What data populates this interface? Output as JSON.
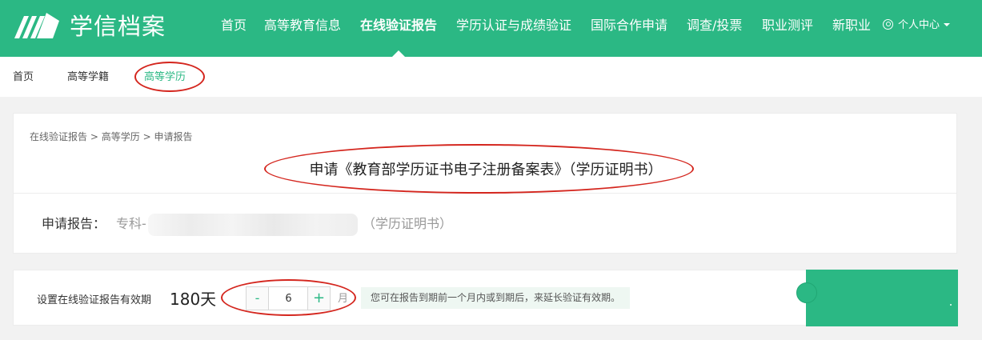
{
  "header": {
    "brand": "学信档案",
    "nav": [
      {
        "label": "首页"
      },
      {
        "label": "高等教育信息"
      },
      {
        "label": "在线验证报告"
      },
      {
        "label": "学历认证与成绩验证"
      },
      {
        "label": "国际合作申请"
      },
      {
        "label": "调查/投票"
      },
      {
        "label": "职业测评"
      },
      {
        "label": "新职业"
      }
    ],
    "active_nav": "在线验证报告",
    "user_menu": "个人中心"
  },
  "subnav": {
    "items": [
      {
        "label": "首页"
      },
      {
        "label": "高等学籍"
      },
      {
        "label": "高等学历"
      }
    ],
    "active": "高等学历"
  },
  "breadcrumb": {
    "items": [
      "在线验证报告",
      "高等学历",
      "申请报告"
    ],
    "separator": ">"
  },
  "page": {
    "title": "申请《教育部学历证书电子注册备案表》（学历证明书）",
    "apply_label": "申请报告：",
    "apply_value": "专科-",
    "apply_suffix": "（学历证明书）"
  },
  "validity": {
    "label": "设置在线验证报告有效期",
    "days": "180天",
    "minus_label": "-",
    "plus_label": "+",
    "months_value": "6",
    "unit": "月",
    "hint": "您可在报告到期前一个月内或到期后，来延长验证有效期。"
  },
  "colors": {
    "brand_green": "#2bb884",
    "annotation_red": "#d4261e"
  },
  "icons": {
    "logo": "book-pages-logo-icon",
    "user": "user-circle-icon",
    "dropdown": "caret-down-icon"
  }
}
